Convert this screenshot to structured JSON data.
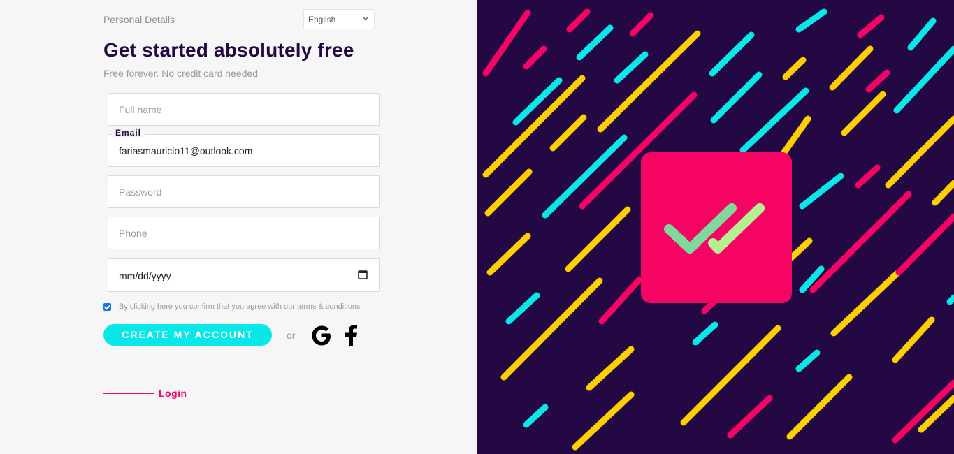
{
  "header": {
    "section_label": "Personal Details",
    "language": "English"
  },
  "heading": "Get started absolutely free",
  "subheading": "Free forever. No credit card needed",
  "form": {
    "full_name_placeholder": "Full name",
    "email_label": "Email",
    "email_value": "fariasmauricio11@outlook.com",
    "password_placeholder": "Password",
    "phone_placeholder": "Phone",
    "date_placeholder": "mm/dd/yyyy",
    "terms_checked": true,
    "terms_text": "By clicking here you confirm that you agree with our terms & conditions"
  },
  "actions": {
    "create_label": "CREATE MY ACCOUNT",
    "or_label": "or",
    "google_icon": "google-icon",
    "facebook_icon": "facebook-icon",
    "login_label": "Login"
  },
  "colors": {
    "brand_dark": "#230844",
    "accent_cyan": "#08e8e8",
    "accent_pink": "#f4086e",
    "stripe_yellow": "#ffd000",
    "check_green": "#9ae3a0"
  }
}
